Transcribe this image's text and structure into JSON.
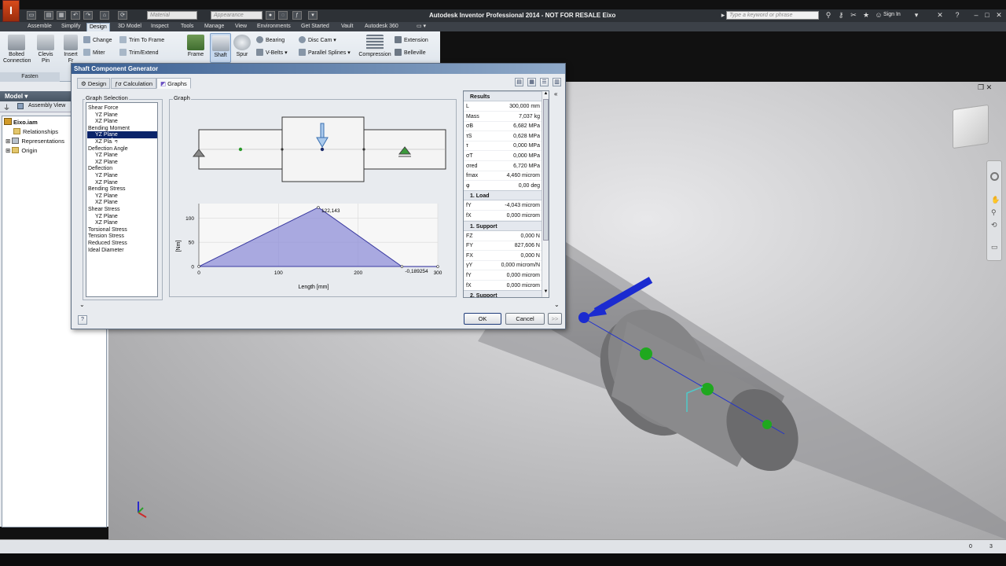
{
  "app": {
    "title": "Autodesk Inventor Professional 2014 - NOT FOR RESALE   Eixo",
    "material_placeholder": "Material",
    "appearance_placeholder": "Appearance",
    "search_placeholder": "Type a keyword or phrase",
    "sign_in": "Sign In"
  },
  "ribbon_tabs": [
    "Assemble",
    "Simplify",
    "Design",
    "3D Model",
    "Inspect",
    "Tools",
    "Manage",
    "View",
    "Environments",
    "Get Started",
    "Vault",
    "Autodesk 360"
  ],
  "ribbon": {
    "bolted": "Bolted\nConnection",
    "clevis": "Clevis\nPin",
    "insert": "Insert\nFr",
    "change": "Change",
    "miter": "Miter",
    "trim_to_frame": "Trim To Frame",
    "trim_extend": "Trim/Extend",
    "frame": "Frame",
    "shaft": "Shaft",
    "spur": "Spur",
    "bearing": "Bearing",
    "vbelts": "V-Belts",
    "disc_cam": "Disc Cam",
    "parallel_splines": "Parallel Splines",
    "compression": "Compression",
    "extension": "Extension",
    "belleville": "Belleville",
    "fasten": "Fasten"
  },
  "browser": {
    "header": "Model ▾",
    "assembly_view": "Assembly View",
    "root": "Eixo.iam",
    "items": [
      "Relationships",
      "Representations",
      "Origin"
    ]
  },
  "dialog": {
    "title": "Shaft Component Generator",
    "tabs": [
      "Design",
      "Calculation",
      "Graphs"
    ],
    "graph_selection_label": "Graph Selection",
    "graph_label": "Graph",
    "graph_items": [
      {
        "label": "Shear Force",
        "sub": false
      },
      {
        "label": "YZ Plane",
        "sub": true
      },
      {
        "label": "XZ Plane",
        "sub": true
      },
      {
        "label": "Bending Moment",
        "sub": false
      },
      {
        "label": "YZ Plane",
        "sub": true,
        "selected": true
      },
      {
        "label": "XZ Plane",
        "sub": true
      },
      {
        "label": "Deflection Angle",
        "sub": false
      },
      {
        "label": "YZ Plane",
        "sub": true
      },
      {
        "label": "XZ Plane",
        "sub": true
      },
      {
        "label": "Deflection",
        "sub": false
      },
      {
        "label": "YZ Plane",
        "sub": true
      },
      {
        "label": "XZ Plane",
        "sub": true
      },
      {
        "label": "Bending Stress",
        "sub": false
      },
      {
        "label": "YZ Plane",
        "sub": true
      },
      {
        "label": "XZ Plane",
        "sub": true
      },
      {
        "label": "Shear Stress",
        "sub": false
      },
      {
        "label": "YZ Plane",
        "sub": true
      },
      {
        "label": "XZ Plane",
        "sub": true
      },
      {
        "label": "Torsional Stress",
        "sub": false
      },
      {
        "label": "Tension Stress",
        "sub": false
      },
      {
        "label": "Reduced Stress",
        "sub": false
      },
      {
        "label": "Ideal Diameter",
        "sub": false
      }
    ],
    "results_header": "Results",
    "results": [
      {
        "k": "L",
        "v": "300,000 mm"
      },
      {
        "k": "Mass",
        "v": "7,037 kg"
      },
      {
        "k": "σB",
        "v": "6,682 MPa"
      },
      {
        "k": "τS",
        "v": "0,628 MPa"
      },
      {
        "k": "τ",
        "v": "0,000 MPa"
      },
      {
        "k": "σT",
        "v": "0,000 MPa"
      },
      {
        "k": "σred",
        "v": "6,720 MPa"
      },
      {
        "k": "fmax",
        "v": "4,460 microm"
      },
      {
        "k": "φ",
        "v": "0,00 deg"
      }
    ],
    "load_header": "1. Load",
    "load": [
      {
        "k": "fY",
        "v": "-4,043 microm"
      },
      {
        "k": "fX",
        "v": "0,000 microm"
      }
    ],
    "support_header": "1. Support",
    "support": [
      {
        "k": "FZ",
        "v": "0,000 N"
      },
      {
        "k": "FY",
        "v": "827,606 N"
      },
      {
        "k": "FX",
        "v": "0,000 N"
      },
      {
        "k": "γY",
        "v": "0,000 microm/N"
      },
      {
        "k": "fY",
        "v": "0,000 microm"
      },
      {
        "k": "fX",
        "v": "0,000 microm"
      }
    ],
    "support2_header": "2. Support",
    "ok": "OK",
    "cancel": "Cancel",
    "more": ">>",
    "help": "?"
  },
  "chart_data": {
    "type": "area",
    "x": [
      0,
      150,
      255,
      300
    ],
    "y": [
      0,
      122.143,
      -0.189254,
      -0.189254
    ],
    "xlim": [
      0,
      300
    ],
    "ylim": [
      0,
      130
    ],
    "xticks": [
      "0",
      "100",
      "200",
      "300"
    ],
    "yticks": [
      "0",
      "50",
      "100"
    ],
    "xlabel": "Length [mm]",
    "ylabel": "[Nm]",
    "annotations": [
      "122,143",
      "-0,189254"
    ],
    "fill": "#8f8fd8"
  },
  "status": {
    "left": "0",
    "right": "3"
  }
}
